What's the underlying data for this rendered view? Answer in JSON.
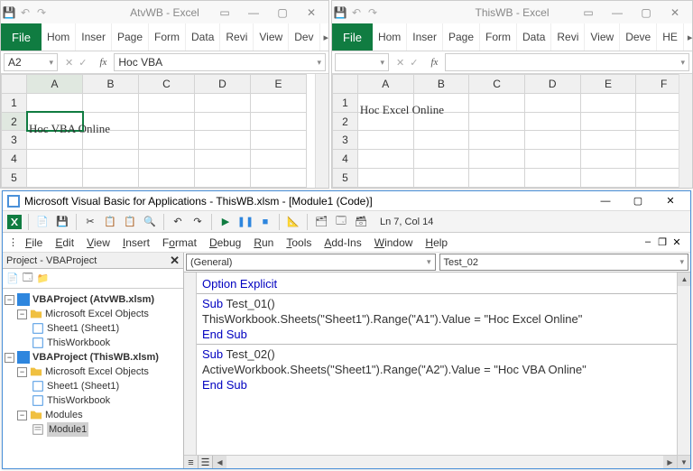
{
  "excel_left": {
    "title": "AtvWB  -  Excel",
    "file_label": "File",
    "tabs": [
      "Hom",
      "Inser",
      "Page",
      "Form",
      "Data",
      "Revi",
      "View",
      "Dev"
    ],
    "namebox": "A2",
    "fx_label": "fx",
    "formula": "Hoc VBA",
    "columns": [
      "A",
      "B",
      "C",
      "D",
      "E"
    ],
    "rows": [
      "1",
      "2",
      "3",
      "4",
      "5"
    ],
    "cell_a2": "Hoc VBA Online",
    "selected_cell": "A2"
  },
  "excel_right": {
    "title": "ThisWB  -  Excel",
    "file_label": "File",
    "tabs": [
      "Hom",
      "Inser",
      "Page",
      "Form",
      "Data",
      "Revi",
      "View",
      "Deve",
      "HE"
    ],
    "namebox": "",
    "fx_label": "fx",
    "formula": "",
    "columns": [
      "A",
      "B",
      "C",
      "D",
      "E",
      "F"
    ],
    "rows": [
      "1",
      "2",
      "3",
      "4",
      "5"
    ],
    "cell_a1": "Hoc Excel Online"
  },
  "vbe": {
    "title": "Microsoft Visual Basic for Applications - ThisWB.xlsm - [Module1 (Code)]",
    "cursor_pos": "Ln 7, Col 14",
    "menu": [
      "File",
      "Edit",
      "View",
      "Insert",
      "Format",
      "Debug",
      "Run",
      "Tools",
      "Add-Ins",
      "Window",
      "Help"
    ],
    "menu_keys": [
      "F",
      "E",
      "V",
      "I",
      "o",
      "D",
      "R",
      "T",
      "A",
      "W",
      "H"
    ],
    "project_title": "Project - VBAProject",
    "dropdown_left": "(General)",
    "dropdown_right": "Test_02",
    "tree": {
      "proj1": "VBAProject (AtvWB.xlsm)",
      "proj2": "VBAProject (ThisWB.xlsm)",
      "meo": "Microsoft Excel Objects",
      "sheet1": "Sheet1 (Sheet1)",
      "thiswb": "ThisWorkbook",
      "modules": "Modules",
      "module1": "Module1"
    },
    "code": {
      "l1": "Option Explicit",
      "l2": "Sub Test_01()",
      "l3": "ThisWorkbook.Sheets(\"Sheet1\").Range(\"A1\").Value = \"Hoc Excel Online\"",
      "l4": "End Sub",
      "l5": "Sub Test_02()",
      "l6": "ActiveWorkbook.Sheets(\"Sheet1\").Range(\"A2\").Value = \"Hoc VBA Online\"",
      "l7": "End Sub"
    }
  }
}
